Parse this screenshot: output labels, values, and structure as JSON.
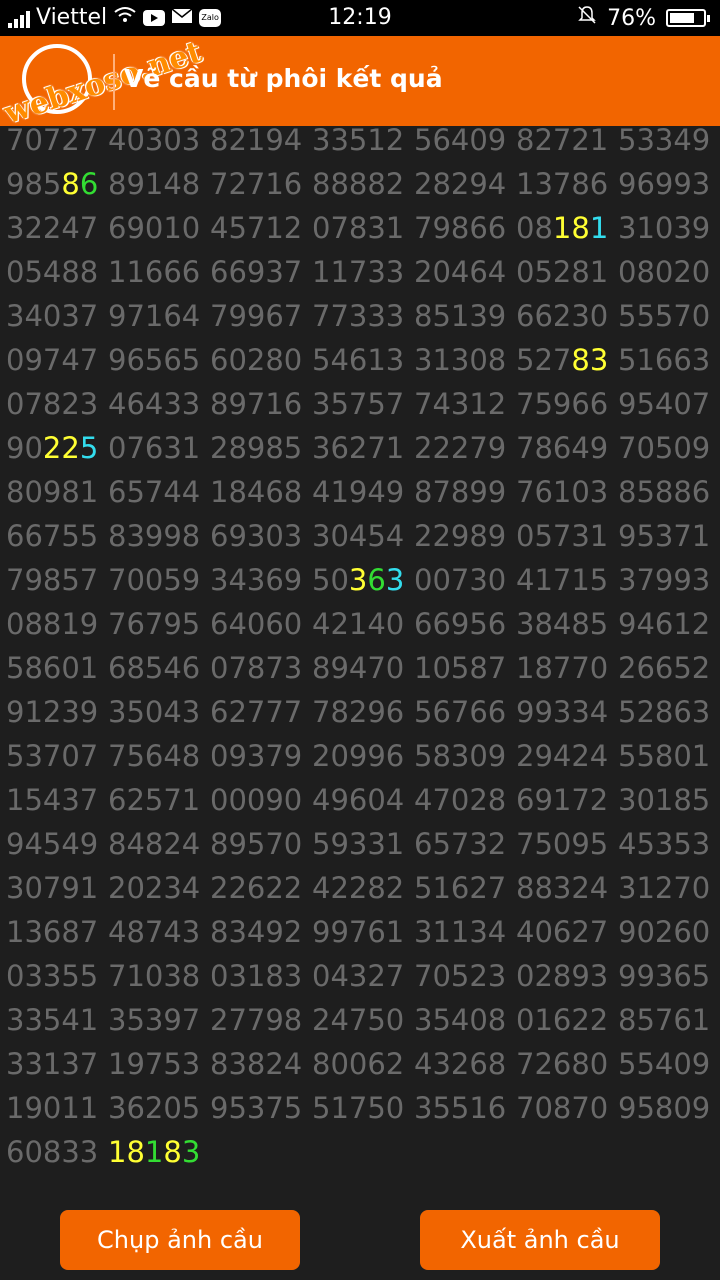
{
  "status": {
    "carrier": "Viettel",
    "time": "12:19",
    "battery": "76%",
    "battery_level": 0.76
  },
  "header": {
    "logo": "webxoso.net",
    "title": "Vẽ cầu từ phôi kết quả"
  },
  "grid": [
    [
      "70727",
      "40303",
      "82194",
      "33512",
      "56409",
      "82721",
      "53349"
    ],
    [
      "98586",
      "89148",
      "72716",
      "88882",
      "28294",
      "13786",
      "96993"
    ],
    [
      "32247",
      "69010",
      "45712",
      "07831",
      "79866",
      "08181",
      "31039"
    ],
    [
      "05488",
      "11666",
      "66937",
      "11733",
      "20464",
      "05281",
      "08020"
    ],
    [
      "34037",
      "97164",
      "79967",
      "77333",
      "85139",
      "66230",
      "55570"
    ],
    [
      "09747",
      "96565",
      "60280",
      "54613",
      "31308",
      "52783",
      "51663"
    ],
    [
      "07823",
      "46433",
      "89716",
      "35757",
      "74312",
      "75966",
      "95407"
    ],
    [
      "90225",
      "07631",
      "28985",
      "36271",
      "22279",
      "78649",
      "70509"
    ],
    [
      "80981",
      "65744",
      "18468",
      "41949",
      "87899",
      "76103",
      "85886"
    ],
    [
      "66755",
      "83998",
      "69303",
      "30454",
      "22989",
      "05731",
      "95371"
    ],
    [
      "79857",
      "70059",
      "34369",
      "50363",
      "00730",
      "41715",
      "37993"
    ],
    [
      "08819",
      "76795",
      "64060",
      "42140",
      "66956",
      "38485",
      "94612"
    ],
    [
      "58601",
      "68546",
      "07873",
      "89470",
      "10587",
      "18770",
      "26652"
    ],
    [
      "91239",
      "35043",
      "62777",
      "78296",
      "56766",
      "99334",
      "52863"
    ],
    [
      "53707",
      "75648",
      "09379",
      "20996",
      "58309",
      "29424",
      "55801"
    ],
    [
      "15437",
      "62571",
      "00090",
      "49604",
      "47028",
      "69172",
      "30185"
    ],
    [
      "94549",
      "84824",
      "89570",
      "59331",
      "65732",
      "75095",
      "45353"
    ],
    [
      "30791",
      "20234",
      "22622",
      "42282",
      "51627",
      "88324",
      "31270"
    ],
    [
      "13687",
      "48743",
      "83492",
      "99761",
      "31134",
      "40627",
      "90260"
    ],
    [
      "03355",
      "71038",
      "03183",
      "04327",
      "70523",
      "02893",
      "99365"
    ],
    [
      "33541",
      "35397",
      "27798",
      "24750",
      "35408",
      "01622",
      "85761"
    ],
    [
      "33137",
      "19753",
      "83824",
      "80062",
      "43268",
      "72680",
      "55409"
    ],
    [
      "19011",
      "36205",
      "95375",
      "51750",
      "35516",
      "70870",
      "95809"
    ],
    [
      "60833",
      "18183"
    ]
  ],
  "highlights": {
    "1-0": [
      "",
      "",
      "",
      "y",
      "g"
    ],
    "2-5": [
      "",
      "",
      "y",
      "y",
      "c"
    ],
    "5-5": [
      "",
      "",
      "",
      "y",
      "y"
    ],
    "7-0": [
      "",
      "",
      "y",
      "y",
      "c"
    ],
    "10-3": [
      "",
      "",
      "y",
      "g",
      "c"
    ],
    "23-1": [
      "y",
      "y",
      "g",
      "y",
      "g"
    ]
  },
  "colors": {
    "accent": "#f26500",
    "background": "#1e1e1e",
    "number": "#6a6a6a",
    "yellow": "#ffff33",
    "green": "#33dd33",
    "cyan": "#33ddee"
  },
  "buttons": {
    "capture": "Chụp ảnh cầu",
    "export": "Xuất ảnh cầu"
  }
}
